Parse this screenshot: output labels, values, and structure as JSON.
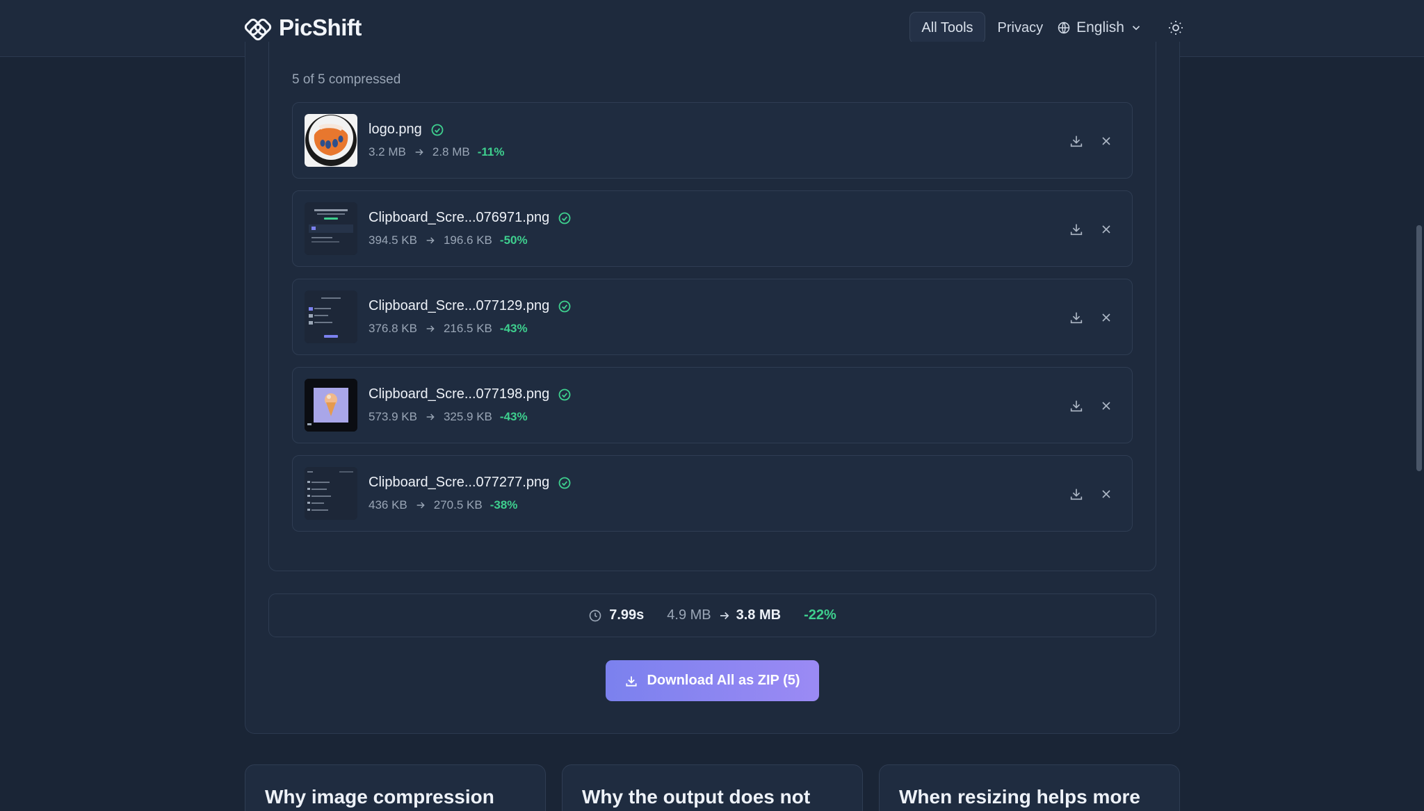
{
  "header": {
    "brand": "PicShift",
    "nav": {
      "all_tools": "All Tools",
      "privacy": "Privacy",
      "language": "English"
    }
  },
  "results": {
    "count_label": "5 of 5 compressed",
    "files": [
      {
        "name": "logo.png",
        "original": "3.2 MB",
        "compressed": "2.8 MB",
        "reduction": "-11%",
        "thumb": "orange-hand"
      },
      {
        "name": "Clipboard_Scre...076971.png",
        "original": "394.5 KB",
        "compressed": "196.6 KB",
        "reduction": "-50%",
        "thumb": "screenshot-a"
      },
      {
        "name": "Clipboard_Scre...077129.png",
        "original": "376.8 KB",
        "compressed": "216.5 KB",
        "reduction": "-43%",
        "thumb": "screenshot-b"
      },
      {
        "name": "Clipboard_Scre...077198.png",
        "original": "573.9 KB",
        "compressed": "325.9 KB",
        "reduction": "-43%",
        "thumb": "ice-cream"
      },
      {
        "name": "Clipboard_Scre...077277.png",
        "original": "436 KB",
        "compressed": "270.5 KB",
        "reduction": "-38%",
        "thumb": "screenshot-c"
      }
    ]
  },
  "summary": {
    "time": "7.99s",
    "original_total": "4.9 MB",
    "compressed_total": "3.8 MB",
    "reduction": "-22%"
  },
  "download_all_label": "Download All as ZIP (5)",
  "faq_cards": [
    {
      "title": "Why image compression"
    },
    {
      "title": "Why the output does not"
    },
    {
      "title": "When resizing helps more"
    }
  ],
  "colors": {
    "background": "#1a2536",
    "card": "#1e2a3d",
    "accent": "#8b86f2",
    "success": "#3ecf8e"
  }
}
